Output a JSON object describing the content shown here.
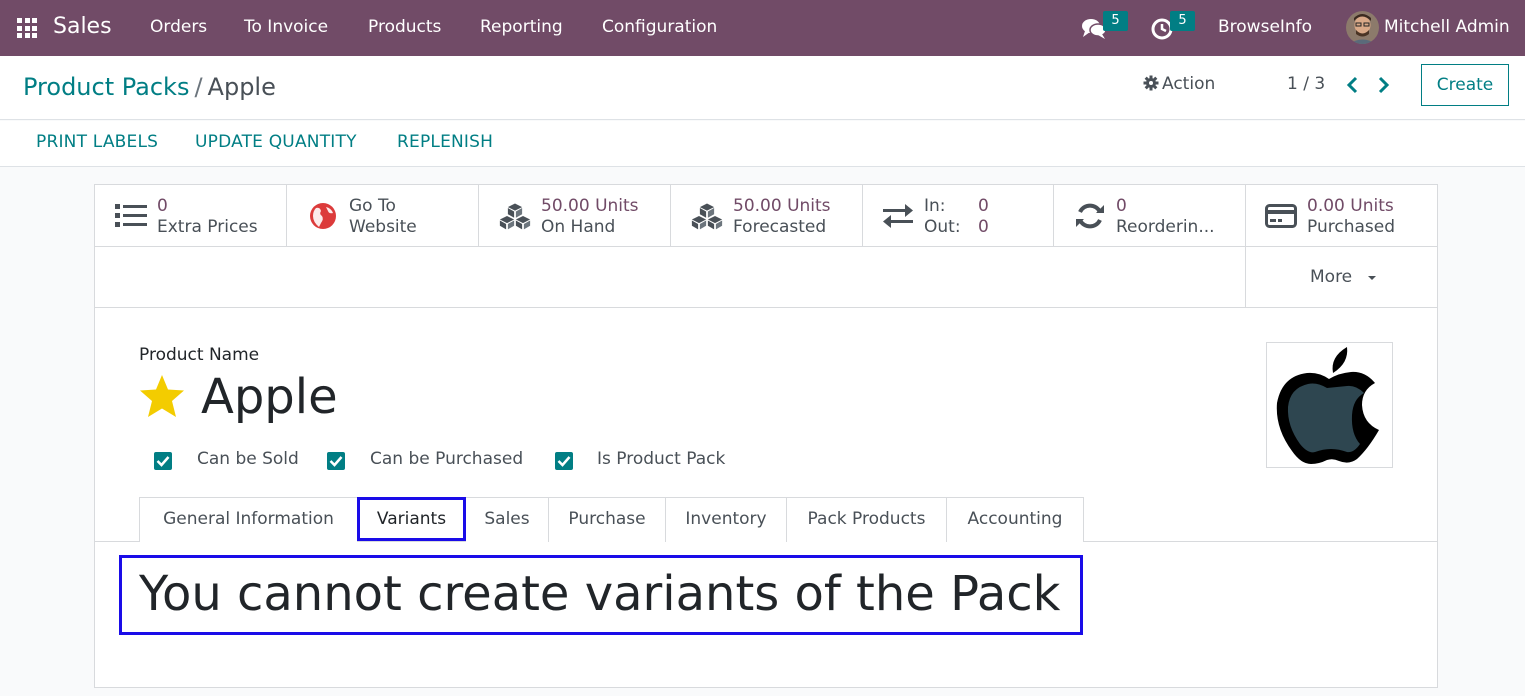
{
  "navbar": {
    "app_name": "Sales",
    "menu": [
      "Orders",
      "To Invoice",
      "Products",
      "Reporting",
      "Configuration"
    ],
    "messages_badge": "5",
    "activities_badge": "5",
    "company": "BrowseInfo",
    "user": "Mitchell Admin",
    "icons": {
      "apps": "grid-icon",
      "messages": "chat-bubbles-icon",
      "activities": "clock-icon"
    }
  },
  "control": {
    "breadcrumb_parent": "Product Packs",
    "breadcrumb_sep": "/",
    "breadcrumb_current": "Apple",
    "action_label": "Action",
    "pager": "1 / 3",
    "create_label": "Create"
  },
  "statusbar": {
    "buttons": [
      "PRINT LABELS",
      "UPDATE QUANTITY",
      "REPLENISH"
    ]
  },
  "smart_buttons": [
    {
      "icon": "list-icon",
      "value": "0",
      "label": "Extra Prices"
    },
    {
      "icon": "globe-icon",
      "value": "Go To",
      "label": "Website"
    },
    {
      "icon": "cubes-icon",
      "value": "50.00 Units",
      "label": "On Hand"
    },
    {
      "icon": "cubes-icon",
      "value": "50.00 Units",
      "label": "Forecasted"
    },
    {
      "icon": "exchange-icon",
      "in_label": "In:",
      "in_value": "0",
      "out_label": "Out:",
      "out_value": "0"
    },
    {
      "icon": "refresh-icon",
      "value": "0",
      "label": "Reorderin..."
    },
    {
      "icon": "credit-card-icon",
      "value": "0.00 Units",
      "label": "Purchased"
    }
  ],
  "more_label": "More",
  "form": {
    "field_label": "Product Name",
    "product_name": "Apple",
    "checkboxes": [
      {
        "label": "Can be Sold",
        "checked": true
      },
      {
        "label": "Can be Purchased",
        "checked": true
      },
      {
        "label": "Is Product Pack",
        "checked": true
      }
    ],
    "tabs": [
      "General Information",
      "Variants",
      "Sales",
      "Purchase",
      "Inventory",
      "Pack Products",
      "Accounting"
    ],
    "active_tab": "Variants",
    "variants_note": "You cannot create variants of the Pack"
  },
  "colors": {
    "navbar": "#714b67",
    "accent": "#017e84",
    "highlight": "#1a0ce8",
    "star": "#f3cc00"
  }
}
